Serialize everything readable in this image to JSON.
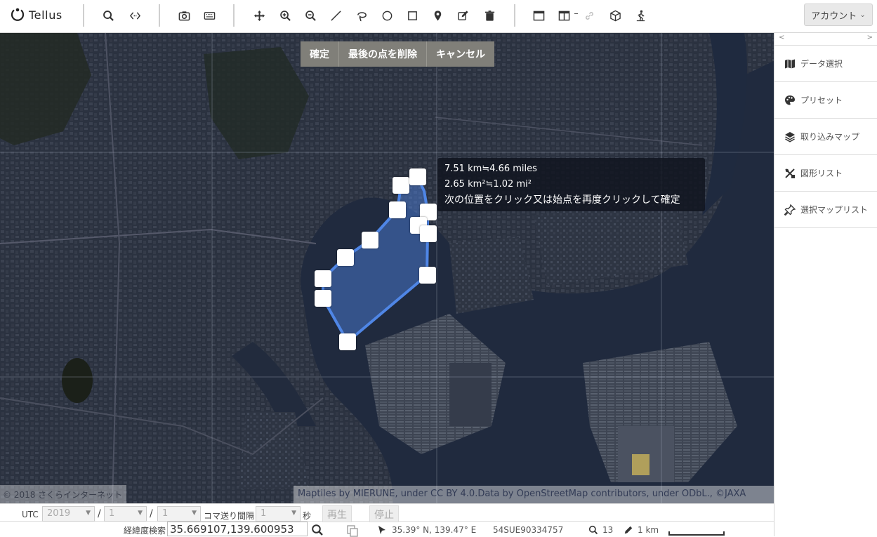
{
  "app": {
    "logo_text": "Tellus"
  },
  "toolbar": {
    "left_tools": [
      "search-icon",
      "embed-code-icon"
    ],
    "capture_tools": [
      "camera-icon",
      "keyboard-icon"
    ],
    "draw_tools": [
      "move-icon",
      "zoom-in-icon",
      "zoom-out-icon",
      "line-icon",
      "lasso-icon",
      "circle-icon",
      "square-icon",
      "pin-icon",
      "edit-icon",
      "trash-icon"
    ],
    "view_tools": [
      "single-window-icon",
      "split-window-icon",
      "link-icon",
      "cube-icon",
      "pedestrian-icon"
    ],
    "account_label": "アカウント"
  },
  "drawing": {
    "confirm_label": "確定",
    "delete_last_label": "最後の点を削除",
    "cancel_label": "キャンセル",
    "tooltip": {
      "distance": "7.51 km≒4.66 miles",
      "area": "2.65 km²≒1.02 mi²",
      "instruction": "次の位置をクリック又は始点を再度クリックして確定"
    },
    "polygon_color": "#4f86e6"
  },
  "map": {
    "copyright_left": "© 2018 さくらインターネット",
    "attribution": "Maptiles by MIERUNE, under CC BY 4.0.Data by OpenStreetMap contributors, under ODbL., ©JAXA"
  },
  "panel": {
    "items": [
      {
        "label": "データ選択",
        "icon": "map-icon"
      },
      {
        "label": "プリセット",
        "icon": "palette-icon"
      },
      {
        "label": "取り込みマップ",
        "icon": "layers-icon"
      },
      {
        "label": "図形リスト",
        "icon": "shapes-icon"
      },
      {
        "label": "選択マップリスト",
        "icon": "pin-list-icon"
      }
    ]
  },
  "time_controls": {
    "utc_label": "UTC",
    "year": "2019",
    "month": "1",
    "day": "1",
    "slash": "/",
    "interval_label": "コマ送り間隔",
    "interval_value": "1",
    "seconds_label": "秒",
    "play_label": "再生",
    "stop_label": "停止"
  },
  "status": {
    "coord_search_label": "経緯度検索",
    "coord_value": "35.669107,139.600953",
    "cursor_latlon": "35.39° N, 139.47° E",
    "grid_code": "54SUE90334757",
    "zoom_level": "13",
    "scale_label": "1 km"
  }
}
